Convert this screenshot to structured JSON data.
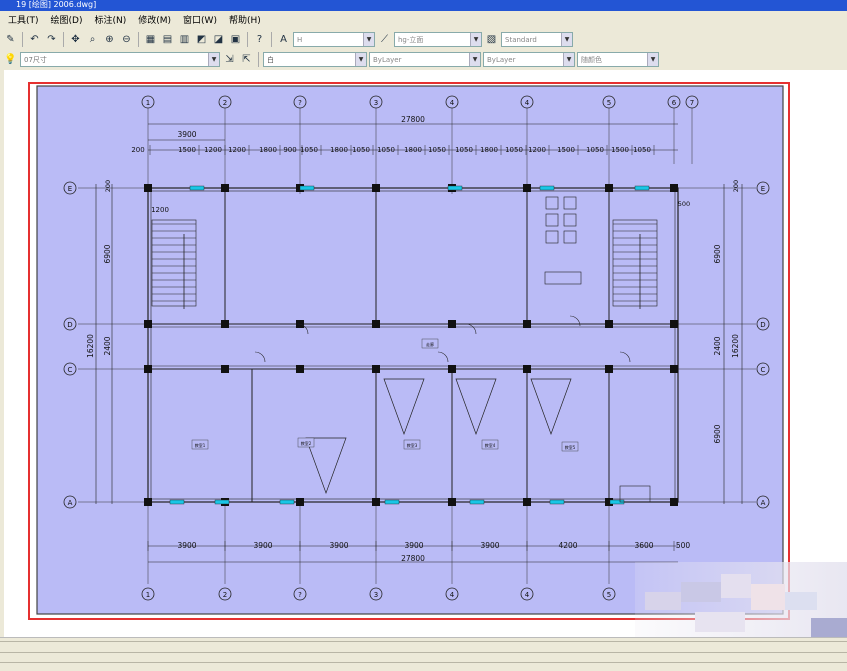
{
  "window": {
    "title": "19 [绘图] 2006.dwg]"
  },
  "menu": [
    "工具(T)",
    "绘图(D)",
    "标注(N)",
    "修改(M)",
    "窗口(W)",
    "帮助(H)"
  ],
  "toolbar": {
    "text_style": "Standard",
    "dim_style": "hg-立面",
    "dim_prefix": "H",
    "standard": "Standard"
  },
  "layers": {
    "layer_name": "07尺寸",
    "color": "白",
    "linetype": "ByLayer",
    "lineweight": "ByLayer",
    "plotstyle": "随颜色"
  },
  "plan": {
    "axes_top": [
      "1",
      "2",
      "?",
      "3",
      "4",
      "4",
      "5",
      "6",
      "7"
    ],
    "axes_bottom": [
      "1",
      "2",
      "?",
      "3",
      "4",
      "4",
      "5"
    ],
    "axes_left": [
      "E",
      "D",
      "C",
      "A"
    ],
    "axes_right": [
      "E",
      "D",
      "C",
      "A"
    ],
    "total_width_top": "27800",
    "total_width_bottom": "27800",
    "top_span": "3900",
    "top_dims": [
      "200",
      "1500",
      "1200",
      "1200",
      "1800",
      "900",
      "1050",
      "1800",
      "1050",
      "1050",
      "1800",
      "1050",
      "1050",
      "1800",
      "1050",
      "1200",
      "1500",
      "1050",
      "1500",
      "1050"
    ],
    "bottom_dims": [
      "3900",
      "3900",
      "3900",
      "3900",
      "3900",
      "4200",
      "3600",
      "500"
    ],
    "left_total": "16200",
    "left_dims": [
      "200",
      "6900",
      "2400"
    ],
    "right_total": "16200",
    "right_dims": [
      "200",
      "6900",
      "2400",
      "6900"
    ],
    "side_dims": [
      "1200",
      "500"
    ],
    "rooms": [
      "教室1",
      "教室2",
      "教室3",
      "教室4",
      "教室5",
      "走廊"
    ]
  },
  "colors": {
    "paper": "#babbf6",
    "frame": "#e53030",
    "titlebar": "#2355d4"
  }
}
